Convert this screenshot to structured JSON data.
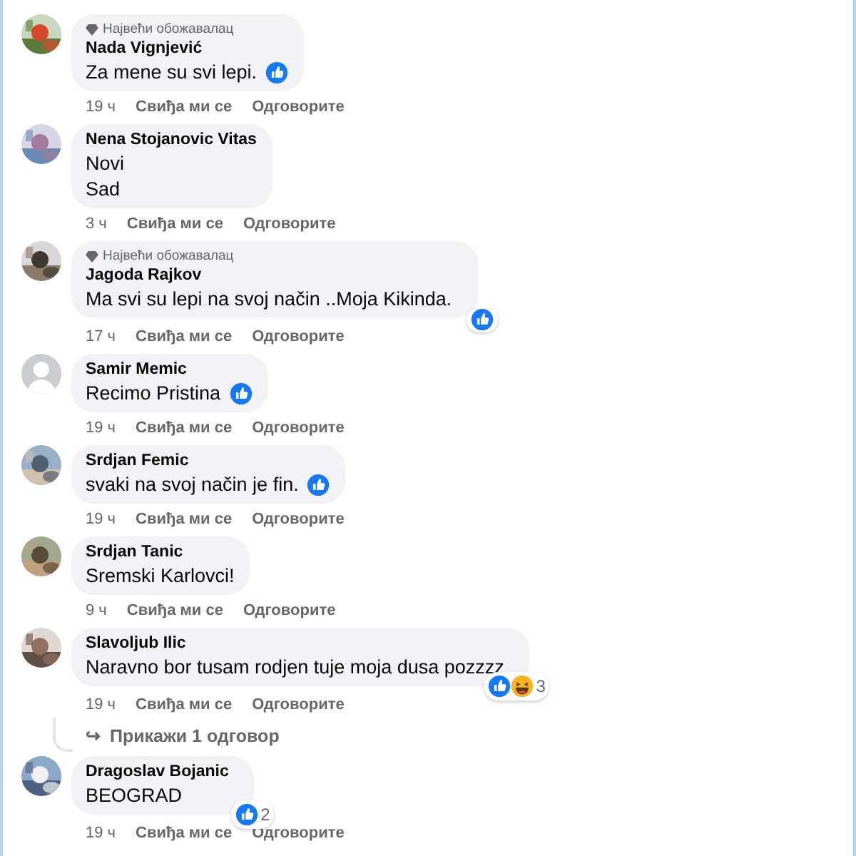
{
  "comments": [
    {
      "avatar": {
        "kind": "picture"
      },
      "badge": "Највећи обожавалац",
      "author": "Nada Vignjević",
      "lines": [
        "Za mene su svi lepi."
      ],
      "reactions": {
        "corner": false,
        "icons": [
          {
            "kind": "like"
          }
        ]
      },
      "time": "19 ч",
      "like": "Свиђа ми се",
      "reply": "Одговорите"
    },
    {
      "avatar": {
        "kind": "picture"
      },
      "author": "Nena Stojanovic Vitas",
      "lines": [
        "Novi",
        "Sad"
      ],
      "time": "3 ч",
      "like": "Свиђа ми се",
      "reply": "Одговорите"
    },
    {
      "avatar": {
        "kind": "picture"
      },
      "badge": "Највећи обожавалац",
      "author": "Jagoda Rajkov",
      "lines": [
        "Ma svi su lepi na svoj način ..Moja Kikinda."
      ],
      "reactions": {
        "corner": true,
        "icons": [
          {
            "kind": "like"
          }
        ]
      },
      "time": "17 ч",
      "like": "Свиђа ми се",
      "reply": "Одговорите"
    },
    {
      "avatar": {
        "kind": "default"
      },
      "author": "Samir Memic",
      "lines": [
        "Recimo Pristina"
      ],
      "reactions": {
        "corner": false,
        "icons": [
          {
            "kind": "like"
          }
        ]
      },
      "time": "19 ч",
      "like": "Свиђа ми се",
      "reply": "Одговорите"
    },
    {
      "avatar": {
        "kind": "picture"
      },
      "author": "Srdjan Femic",
      "lines": [
        "svaki na svoj način je fin."
      ],
      "reactions": {
        "corner": false,
        "icons": [
          {
            "kind": "like"
          }
        ]
      },
      "time": "19 ч",
      "like": "Свиђа ми се",
      "reply": "Одговорите"
    },
    {
      "avatar": {
        "kind": "picture"
      },
      "author": "Srdjan Tanic",
      "lines": [
        "Sremski Karlovci!"
      ],
      "time": "9 ч",
      "like": "Свиђа ми се",
      "reply": "Одговорите"
    },
    {
      "avatar": {
        "kind": "picture"
      },
      "author": "Slavoljub Ilic",
      "lines": [
        "Naravno bor tusam rodjen tuje moja dusa pozzzz"
      ],
      "reactions": {
        "corner": true,
        "icons": [
          {
            "kind": "like"
          },
          {
            "kind": "haha"
          }
        ],
        "count": "3"
      },
      "time": "19 ч",
      "like": "Свиђа ми се",
      "reply": "Одговорите",
      "replies_link": {
        "arrow": "↪",
        "label": "Прикажи 1 одговор"
      }
    },
    {
      "avatar": {
        "kind": "picture"
      },
      "author": "Dragoslav Bojanic",
      "lines": [
        "BEOGRAD"
      ],
      "reactions": {
        "corner": true,
        "icons": [
          {
            "kind": "like"
          }
        ],
        "count": "2"
      },
      "time": "19 ч",
      "like": "Свиђа ми се",
      "reply": "Одговорите"
    }
  ]
}
